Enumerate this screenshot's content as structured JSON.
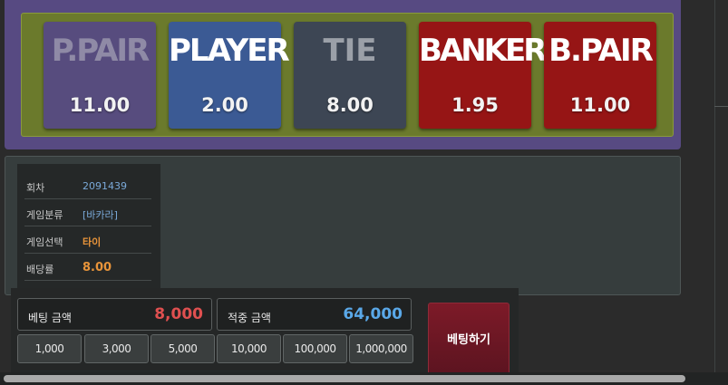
{
  "bet_options": [
    {
      "name": "P.PAIR",
      "odds": "11.00"
    },
    {
      "name": "PLAYER",
      "odds": "2.00"
    },
    {
      "name": "TIE",
      "odds": "8.00"
    },
    {
      "name": "BANKER",
      "odds": "1.95"
    },
    {
      "name": "B.PAIR",
      "odds": "11.00"
    }
  ],
  "info": {
    "round": {
      "label": "회차",
      "value": "2091439"
    },
    "category": {
      "label": "게임분류",
      "value": "[바카라]"
    },
    "selection": {
      "label": "게임선택",
      "value": "타이"
    },
    "odds": {
      "label": "배당률",
      "value": "8.00"
    }
  },
  "betting": {
    "bet_amount_label": "베팅 금액",
    "bet_amount_value": "8,000",
    "win_amount_label": "적중 금액",
    "win_amount_value": "64,000",
    "chips": [
      "1,000",
      "3,000",
      "5,000",
      "10,000",
      "100,000",
      "1,000,000"
    ],
    "place_bet_label": "베팅하기"
  },
  "colors": {
    "player": "#3b5a94",
    "banker": "#961515",
    "board": "#6b7a2c",
    "frame": "#574a82"
  }
}
